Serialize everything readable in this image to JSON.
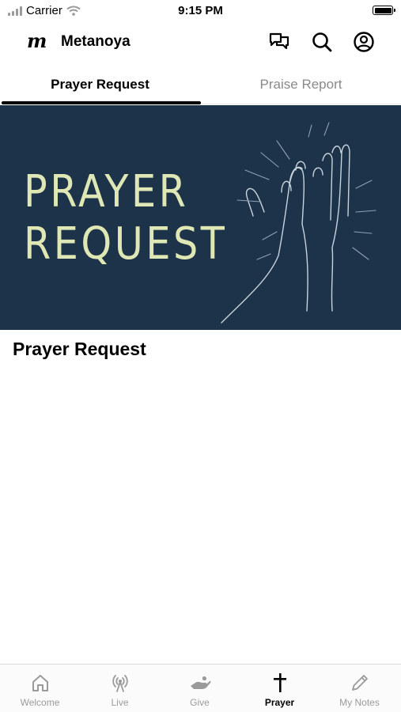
{
  "status_bar": {
    "carrier": "Carrier",
    "time": "9:15 PM"
  },
  "header": {
    "logo": "m",
    "title": "Metanoya",
    "icons": [
      "chat-icon",
      "search-icon",
      "profile-icon"
    ]
  },
  "tabs": [
    {
      "label": "Prayer Request",
      "active": true
    },
    {
      "label": "Praise Report",
      "active": false
    }
  ],
  "banner": {
    "line1": "PRAYER",
    "line2": "REQUEST",
    "background": "#1c3349",
    "text_color": "#dfe8b4"
  },
  "section_title": "Prayer Request",
  "bottom_nav": [
    {
      "label": "Welcome",
      "icon": "home-icon",
      "active": false
    },
    {
      "label": "Live",
      "icon": "broadcast-icon",
      "active": false
    },
    {
      "label": "Give",
      "icon": "giving-hand-icon",
      "active": false
    },
    {
      "label": "Prayer",
      "icon": "cross-icon",
      "active": true
    },
    {
      "label": "My Notes",
      "icon": "pencil-icon",
      "active": false
    }
  ]
}
